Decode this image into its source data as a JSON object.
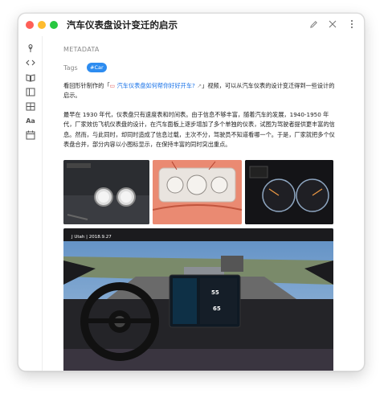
{
  "window": {
    "title": "汽车仪表盘设计变迁的启示"
  },
  "icons": {
    "edit": "pencil-icon",
    "close": "close-icon",
    "more": "more-vertical-icon",
    "rail": [
      "feather-icon",
      "code-icon",
      "book-icon",
      "sidebar-icon",
      "grid-icon",
      "font-icon",
      "calendar-icon",
      "settings-icon"
    ]
  },
  "meta": {
    "label": "METADATA",
    "tags_label": "Tags",
    "tags": [
      "#Car"
    ]
  },
  "body": {
    "para1_prefix": "看回形针制作的「",
    "para1_link": "汽车仪表盘如何帮你好好开车?",
    "para1_suffix": "」视频，可以从汽车仪表的设计变迁得到一些设计的启示。",
    "para2": "最早在 1930 年代，仪表盘只有速度表和时间表。由于信息不够丰富，随着汽车的发展，1940-1950 年代，厂家效仿飞机仪表盘的设计，在汽车面板上逐步增加了多个单独的仪表，试图为驾驶者提供更丰富的信息。然而，与此同时，却同时造成了信息过载，主次不分，驾驶员不知道看哪一个。于是，厂家就把多个仪表盘合并，部分内容以小图标显示，在保持丰富的同时突出重点。"
  },
  "images": {
    "video_caption": "J Utah | 2018.9.27",
    "dash_speed": "55",
    "dash_speed2": "65"
  }
}
